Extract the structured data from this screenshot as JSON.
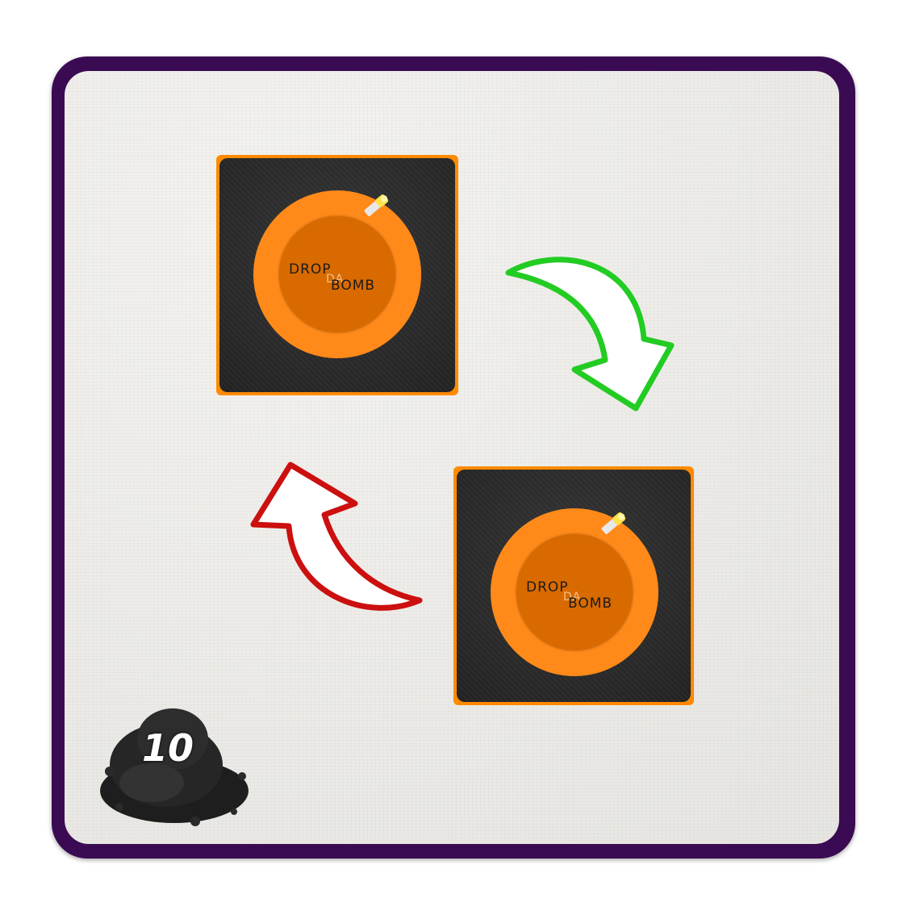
{
  "card": {
    "frame_color": "#3a0b52",
    "face_color": "#ecebe8"
  },
  "tiles": [
    {
      "logo": {
        "word1": "DROP",
        "word2": "DA",
        "word3": "BOMB"
      }
    },
    {
      "logo": {
        "word1": "DROP",
        "word2": "DA",
        "word3": "BOMB"
      }
    }
  ],
  "arrows": {
    "forward": {
      "color": "#22cc22",
      "direction": "clockwise"
    },
    "backward": {
      "color": "#cc0f0f",
      "direction": "counter-clockwise"
    }
  },
  "badge": {
    "value": "10",
    "icon": "powder-pile-icon"
  },
  "colors": {
    "tile_border": "#ff8a00",
    "bomb_outer": "#ff8a1a",
    "bomb_inner": "#d96a00"
  }
}
